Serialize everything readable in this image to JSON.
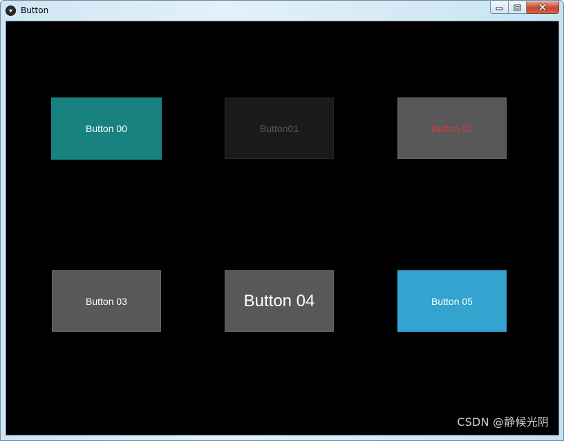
{
  "window": {
    "title": "Button",
    "icon": "kivy-app-icon",
    "frame_color": "#6d8aa3"
  },
  "caption_buttons": {
    "minimize_icon": "minimize-icon",
    "maximize_icon": "maximize-icon",
    "close_icon": "close-icon"
  },
  "buttons": [
    {
      "label": "Button 00",
      "background": "#188280",
      "text_color": "#ffffff"
    },
    {
      "label": "Button01",
      "background": "#1a1a1a",
      "text_color": "#595959"
    },
    {
      "label": "Button 02",
      "background": "#585858",
      "text_color": "#d8393f"
    },
    {
      "label": "Button 03",
      "background": "#585858",
      "text_color": "#ffffff"
    },
    {
      "label": "Button 04",
      "background": "#585858",
      "text_color": "#ffffff"
    },
    {
      "label": "Button 05",
      "background": "#33a3d0",
      "text_color": "#ffffff"
    }
  ],
  "watermark": "CSDN @静候光阴"
}
